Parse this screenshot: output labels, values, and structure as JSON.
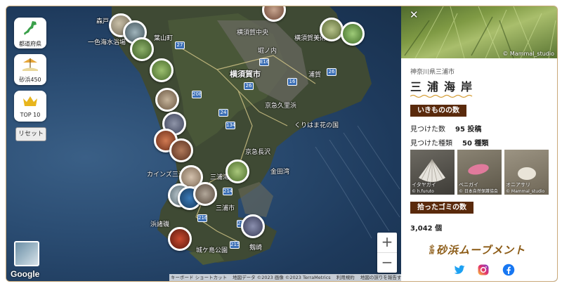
{
  "map": {
    "places": [
      {
        "name": "森戸",
        "big": false
      },
      {
        "name": "葉山町",
        "big": false
      },
      {
        "name": "一色海水浴場",
        "big": false
      },
      {
        "name": "横須賀市",
        "big": true
      },
      {
        "name": "横須賀美術館",
        "big": false
      },
      {
        "name": "横須賀中央",
        "big": false
      },
      {
        "name": "京急久里浜",
        "big": false
      },
      {
        "name": "くりはま花の国",
        "big": false
      },
      {
        "name": "京急長沢",
        "big": false
      },
      {
        "name": "カインズ三浦",
        "big": false
      },
      {
        "name": "三浦海",
        "big": false
      },
      {
        "name": "三浦市",
        "big": false
      },
      {
        "name": "浜諸磯",
        "big": false
      },
      {
        "name": "城ケ島公園",
        "big": false
      },
      {
        "name": "剱崎",
        "big": false
      },
      {
        "name": "浦賀",
        "big": false
      },
      {
        "name": "金田湾",
        "big": false
      },
      {
        "name": "堀ノ内",
        "big": false
      }
    ],
    "roads": [
      "27",
      "26",
      "E16",
      "134",
      "24",
      "26",
      "214",
      "215",
      "216",
      "215",
      "16",
      "208"
    ],
    "google_logo": "Google",
    "attribution": [
      "キーボード ショートカット",
      "地図データ ©2023 画像 ©2023 TerraMetrics",
      "利用規約",
      "地図の誤りを報告する"
    ],
    "zoom_in": "+",
    "zoom_out": "−"
  },
  "sidebar": {
    "buttons": [
      {
        "label": "都道府県",
        "icon": "japan-map-icon"
      },
      {
        "label": "砂浜450",
        "icon": "beach-icon"
      },
      {
        "label": "TOP 10",
        "icon": "crown-icon"
      }
    ],
    "reset": "リセット"
  },
  "panel": {
    "close": "✕",
    "photo_credit": "© Mammal_studio",
    "prefecture": "神奈川県三浦市",
    "beach_name": "三浦海岸",
    "creatures_header": "いきものの数",
    "found_count_label": "見つけた数",
    "found_count_value": "95 投稿",
    "species_label": "見つけた種類",
    "species_value": "50 種類",
    "photos": [
      {
        "name": "イタヤガイ",
        "credit": "© h.furuto"
      },
      {
        "name": "ベニガイ",
        "credit": "© 日本自然保護協会"
      },
      {
        "name": "オニアサリ",
        "credit": "© Mammal_studio"
      }
    ],
    "garbage_header": "拾ったゴミの数",
    "garbage_value": "3,042 個",
    "logo_prefix": "全国",
    "logo_text": "砂浜ムーブメント",
    "social": [
      "twitter-icon",
      "instagram-icon",
      "facebook-icon"
    ],
    "colors": {
      "header_bg": "#5a2a0c",
      "logo": "#8b5a14",
      "border": "#c9a979",
      "twitter": "#1da1f2",
      "facebook": "#1877f2"
    }
  }
}
